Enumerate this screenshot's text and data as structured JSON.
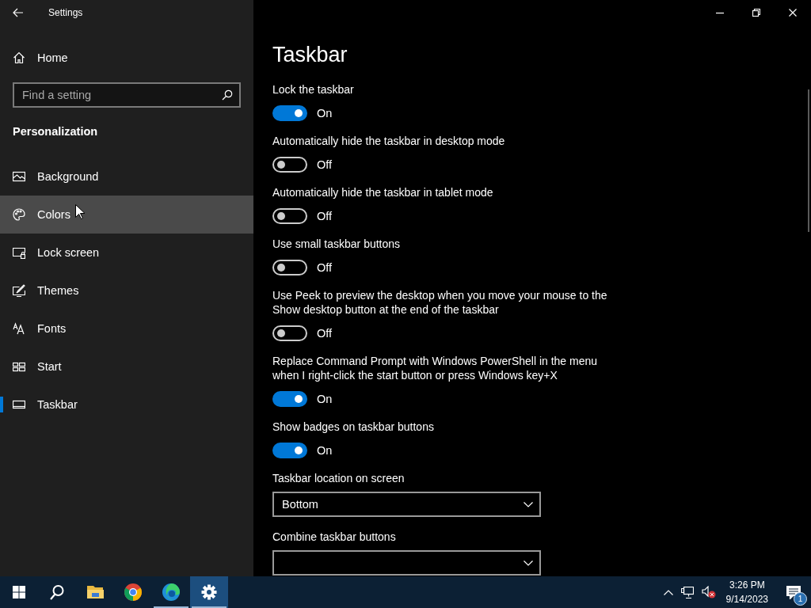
{
  "window": {
    "title": "Settings"
  },
  "sidebar": {
    "home": "Home",
    "search": {
      "placeholder": "Find a setting"
    },
    "section": "Personalization",
    "items": [
      {
        "label": "Background",
        "selected": false,
        "hovered": false
      },
      {
        "label": "Colors",
        "selected": false,
        "hovered": true
      },
      {
        "label": "Lock screen",
        "selected": false,
        "hovered": false
      },
      {
        "label": "Themes",
        "selected": false,
        "hovered": false
      },
      {
        "label": "Fonts",
        "selected": false,
        "hovered": false
      },
      {
        "label": "Start",
        "selected": false,
        "hovered": false
      },
      {
        "label": "Taskbar",
        "selected": true,
        "hovered": false
      }
    ]
  },
  "page": {
    "title": "Taskbar",
    "settings": [
      {
        "kind": "toggle",
        "label": "Lock the taskbar",
        "on": true,
        "state": "On"
      },
      {
        "kind": "toggle",
        "label": "Automatically hide the taskbar in desktop mode",
        "on": false,
        "state": "Off"
      },
      {
        "kind": "toggle",
        "label": "Automatically hide the taskbar in tablet mode",
        "on": false,
        "state": "Off"
      },
      {
        "kind": "toggle",
        "label": "Use small taskbar buttons",
        "on": false,
        "state": "Off"
      },
      {
        "kind": "toggle",
        "label": "Use Peek to preview the desktop when you move your mouse to the Show desktop button at the end of the taskbar",
        "on": false,
        "state": "Off"
      },
      {
        "kind": "toggle",
        "label": "Replace Command Prompt with Windows PowerShell in the menu when I right-click the start button or press Windows key+X",
        "on": true,
        "state": "On"
      },
      {
        "kind": "toggle",
        "label": "Show badges on taskbar buttons",
        "on": true,
        "state": "On"
      },
      {
        "kind": "dropdown",
        "label": "Taskbar location on screen",
        "value": "Bottom"
      },
      {
        "kind": "dropdown",
        "label": "Combine taskbar buttons"
      }
    ]
  },
  "taskbar": {
    "apps": [
      {
        "active": false,
        "running": false
      },
      {
        "active": false,
        "running": false
      },
      {
        "active": false,
        "running": false
      },
      {
        "active": false,
        "running": true
      },
      {
        "active": true,
        "running": true
      }
    ],
    "clock": {
      "time": "3:26 PM",
      "date": "9/14/2023"
    },
    "notifications": {
      "count": "1"
    }
  }
}
